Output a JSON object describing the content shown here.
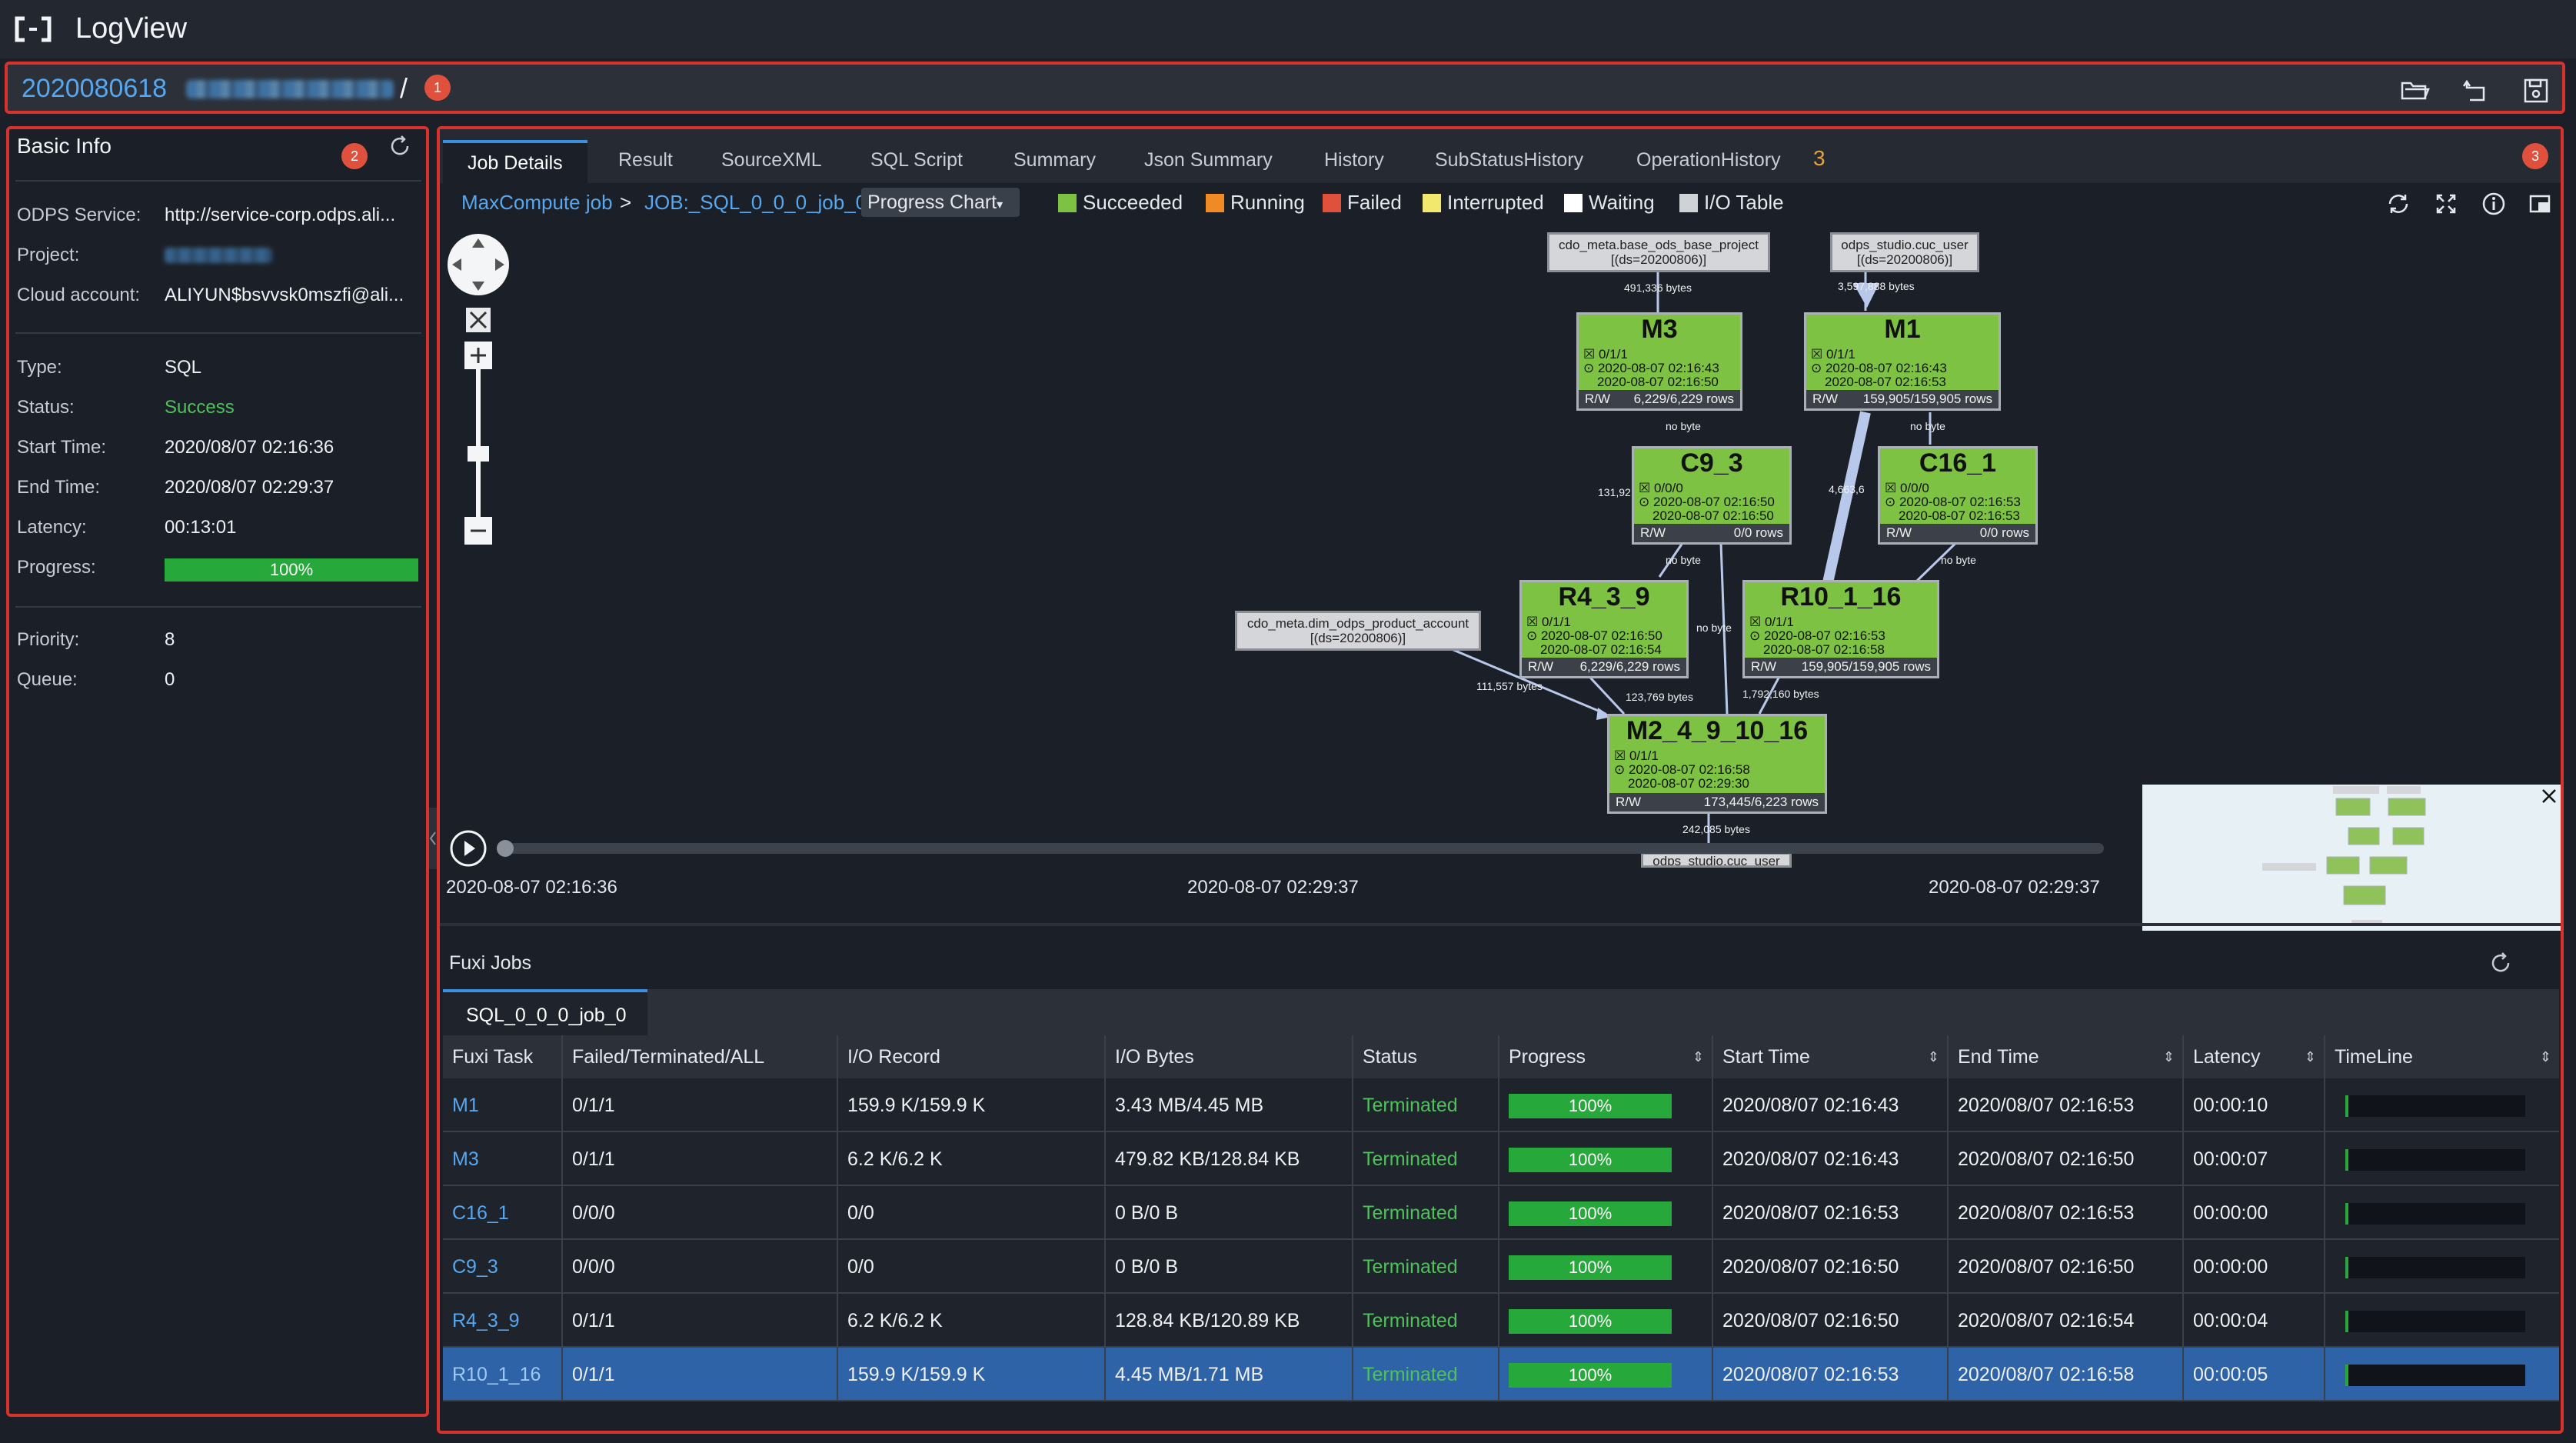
{
  "app": {
    "name": "LogView"
  },
  "jobbar": {
    "job_id": "2020080618",
    "separator": "/",
    "badge": "1"
  },
  "basic_info": {
    "title": "Basic Info",
    "badge": "2",
    "fields": [
      {
        "label": "ODPS Service:",
        "value": "http://service-corp.odps.ali..."
      },
      {
        "label": "Project:",
        "value": ""
      },
      {
        "label": "Cloud account:",
        "value": "ALIYUN$bsvvsk0mszfi@ali..."
      },
      {
        "label": "Type:",
        "value": "SQL"
      },
      {
        "label": "Status:",
        "value": "Success"
      },
      {
        "label": "Start Time:",
        "value": "2020/08/07 02:16:36"
      },
      {
        "label": "End Time:",
        "value": "2020/08/07 02:29:37"
      },
      {
        "label": "Latency:",
        "value": "00:13:01"
      },
      {
        "label": "Progress:",
        "value": "100%"
      },
      {
        "label": "Priority:",
        "value": "8"
      },
      {
        "label": "Queue:",
        "value": "0"
      }
    ]
  },
  "tabs": [
    "Job Details",
    "Result",
    "SourceXML",
    "SQL Script",
    "Summary",
    "Json Summary",
    "History",
    "SubStatusHistory",
    "OperationHistory"
  ],
  "tabs_badge_inline": "3",
  "tabs_badge": "3",
  "breadcrumb": {
    "root": "MaxCompute job",
    "sep": ">",
    "job": "JOB:_SQL_0_0_0_job_0",
    "view": "Progress Chart"
  },
  "legend": [
    {
      "label": "Succeeded",
      "color": "#7dc242"
    },
    {
      "label": "Running",
      "color": "#f08a24"
    },
    {
      "label": "Failed",
      "color": "#e0513d"
    },
    {
      "label": "Interrupted",
      "color": "#f2e86d"
    },
    {
      "label": "Waiting",
      "color": "#ffffff"
    },
    {
      "label": "I/O Table",
      "color": "#cfd2d6"
    }
  ],
  "graph": {
    "tables": {
      "t1": {
        "name": "cdo_meta.base_ods_base_project",
        "part": "[(ds=20200806)]"
      },
      "t2": {
        "name": "odps_studio.cuc_user",
        "part": "[(ds=20200806)]"
      },
      "t3": {
        "name": "cdo_meta.dim_odps_product_account",
        "part": "[(ds=20200806)]"
      },
      "t4": {
        "name": "odps_studio.cuc_user"
      }
    },
    "nodes": {
      "m3": {
        "name": "M3",
        "inst": "☒ 0/1/1",
        "start": "⊙ 2020-08-07 02:16:43",
        "end": "2020-08-07 02:16:50",
        "rw_label": "R/W",
        "rows": "6,229/6,229 rows"
      },
      "m1": {
        "name": "M1",
        "inst": "☒ 0/1/1",
        "start": "⊙ 2020-08-07 02:16:43",
        "end": "2020-08-07 02:16:53",
        "rw_label": "R/W",
        "rows": "159,905/159,905 rows"
      },
      "c9": {
        "name": "C9_3",
        "inst": "☒ 0/0/0",
        "start": "⊙ 2020-08-07 02:16:50",
        "end": "2020-08-07 02:16:50",
        "rw_label": "R/W",
        "rows": "0/0 rows"
      },
      "c16": {
        "name": "C16_1",
        "inst": "☒ 0/0/0",
        "start": "⊙ 2020-08-07 02:16:53",
        "end": "2020-08-07 02:16:53",
        "rw_label": "R/W",
        "rows": "0/0 rows"
      },
      "r4": {
        "name": "R4_3_9",
        "inst": "☒ 0/1/1",
        "start": "⊙ 2020-08-07 02:16:50",
        "end": "2020-08-07 02:16:54",
        "rw_label": "R/W",
        "rows": "6,229/6,229 rows"
      },
      "r10": {
        "name": "R10_1_16",
        "inst": "☒ 0/1/1",
        "start": "⊙ 2020-08-07 02:16:53",
        "end": "2020-08-07 02:16:58",
        "rw_label": "R/W",
        "rows": "159,905/159,905 rows"
      },
      "m2": {
        "name": "M2_4_9_10_16",
        "inst": "☒ 0/1/1",
        "start": "⊙ 2020-08-07 02:16:58",
        "end": "2020-08-07 02:29:30",
        "rw_label": "R/W",
        "rows": "173,445/6,223 rows"
      }
    },
    "edge_labels": {
      "e1": "491,336 bytes",
      "e2": "3,597,888 bytes",
      "e3": "no byte",
      "e4": "no byte",
      "e5": "131,92",
      "e6": "4,663,6",
      "e7": "no byte",
      "e8": "no byte",
      "e9": "no byte",
      "e10": "111,557 bytes",
      "e11": "123,769 bytes",
      "e12": "1,792,160 bytes",
      "e13": "242,085 bytes"
    }
  },
  "timeline": {
    "start": "2020-08-07 02:16:36",
    "mid": "2020-08-07 02:29:37",
    "end": "2020-08-07 02:29:37"
  },
  "fuxi": {
    "title": "Fuxi Jobs",
    "subtab": "SQL_0_0_0_job_0",
    "columns": [
      "Fuxi Task",
      "Failed/Terminated/ALL",
      "I/O Record",
      "I/O Bytes",
      "Status",
      "Progress",
      "Start Time",
      "End Time",
      "Latency",
      "TimeLine"
    ],
    "rows": [
      {
        "task": "M1",
        "fta": "0/1/1",
        "rec": "159.9 K/159.9 K",
        "bytes": "3.43 MB/4.45 MB",
        "status": "Terminated",
        "progress": "100%",
        "start": "2020/08/07 02:16:43",
        "end": "2020/08/07 02:16:53",
        "latency": "00:00:10"
      },
      {
        "task": "M3",
        "fta": "0/1/1",
        "rec": "6.2 K/6.2 K",
        "bytes": "479.82 KB/128.84 KB",
        "status": "Terminated",
        "progress": "100%",
        "start": "2020/08/07 02:16:43",
        "end": "2020/08/07 02:16:50",
        "latency": "00:00:07"
      },
      {
        "task": "C16_1",
        "fta": "0/0/0",
        "rec": "0/0",
        "bytes": "0 B/0 B",
        "status": "Terminated",
        "progress": "100%",
        "start": "2020/08/07 02:16:53",
        "end": "2020/08/07 02:16:53",
        "latency": "00:00:00"
      },
      {
        "task": "C9_3",
        "fta": "0/0/0",
        "rec": "0/0",
        "bytes": "0 B/0 B",
        "status": "Terminated",
        "progress": "100%",
        "start": "2020/08/07 02:16:50",
        "end": "2020/08/07 02:16:50",
        "latency": "00:00:00"
      },
      {
        "task": "R4_3_9",
        "fta": "0/1/1",
        "rec": "6.2 K/6.2 K",
        "bytes": "128.84 KB/120.89 KB",
        "status": "Terminated",
        "progress": "100%",
        "start": "2020/08/07 02:16:50",
        "end": "2020/08/07 02:16:54",
        "latency": "00:00:04"
      },
      {
        "task": "R10_1_16",
        "fta": "0/1/1",
        "rec": "159.9 K/159.9 K",
        "bytes": "4.45 MB/1.71 MB",
        "status": "Terminated",
        "progress": "100%",
        "start": "2020/08/07 02:16:53",
        "end": "2020/08/07 02:16:58",
        "latency": "00:00:05"
      }
    ]
  }
}
